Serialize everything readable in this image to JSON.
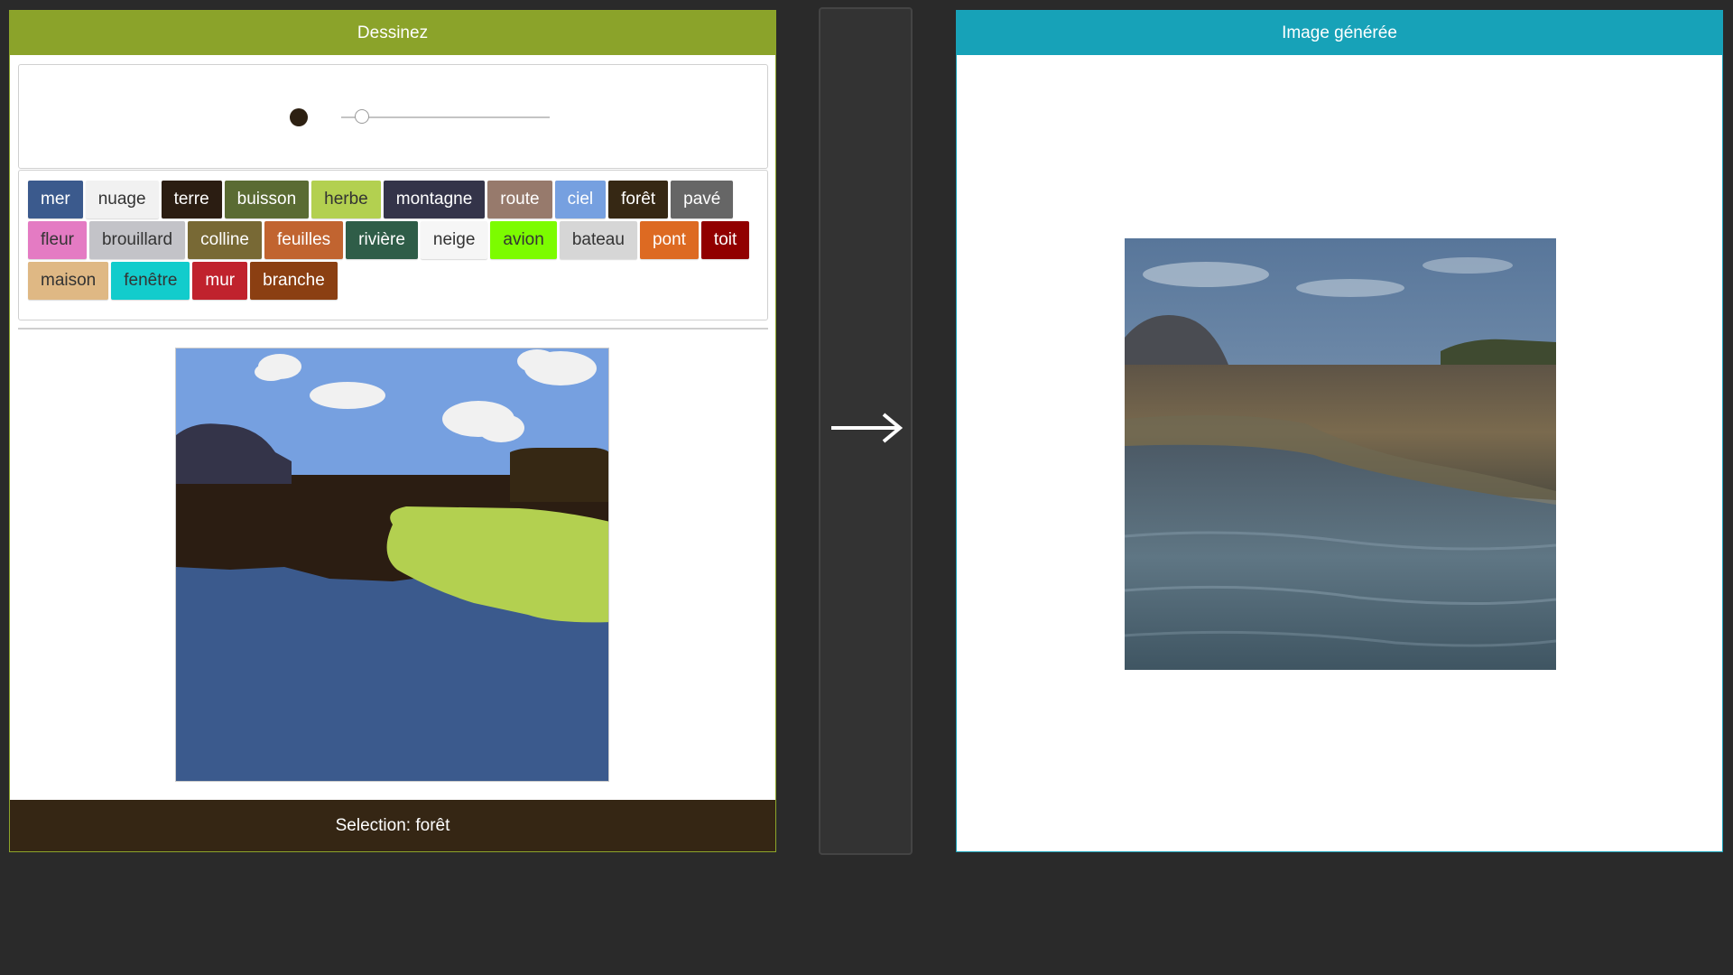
{
  "left_panel": {
    "title": "Dessinez",
    "selection_text": "Selection: forêt",
    "brush_color": "#2d2012",
    "brush_size_level": 0.1
  },
  "labels": [
    {
      "name": "mer",
      "bg": "#3b5a8d",
      "fg": "#ffffff"
    },
    {
      "name": "nuage",
      "bg": "#f1f1f1",
      "fg": "#333333"
    },
    {
      "name": "terre",
      "bg": "#2b1d12",
      "fg": "#ffffff"
    },
    {
      "name": "buisson",
      "bg": "#5a6b33",
      "fg": "#ffffff"
    },
    {
      "name": "herbe",
      "bg": "#b3d050",
      "fg": "#333333"
    },
    {
      "name": "montagne",
      "bg": "#343449",
      "fg": "#ffffff"
    },
    {
      "name": "route",
      "bg": "#977a6c",
      "fg": "#ffffff"
    },
    {
      "name": "ciel",
      "bg": "#76a0e0",
      "fg": "#ffffff"
    },
    {
      "name": "forêt",
      "bg": "#362814",
      "fg": "#ffffff"
    },
    {
      "name": "pavé",
      "bg": "#666666",
      "fg": "#ffffff"
    },
    {
      "name": "fleur",
      "bg": "#e47bc3",
      "fg": "#333333"
    },
    {
      "name": "brouillard",
      "bg": "#c3c3c8",
      "fg": "#333333"
    },
    {
      "name": "colline",
      "bg": "#786935",
      "fg": "#ffffff"
    },
    {
      "name": "feuilles",
      "bg": "#c16430",
      "fg": "#ffffff"
    },
    {
      "name": "rivière",
      "bg": "#2f5d48",
      "fg": "#ffffff"
    },
    {
      "name": "neige",
      "bg": "#f6f6f6",
      "fg": "#333333"
    },
    {
      "name": "avion",
      "bg": "#7cfc00",
      "fg": "#333333"
    },
    {
      "name": "bateau",
      "bg": "#d6d6d6",
      "fg": "#333333"
    },
    {
      "name": "pont",
      "bg": "#dd6a22",
      "fg": "#ffffff"
    },
    {
      "name": "toit",
      "bg": "#910000",
      "fg": "#ffffff"
    },
    {
      "name": "maison",
      "bg": "#dfb884",
      "fg": "#333333"
    },
    {
      "name": "fenêtre",
      "bg": "#12cccc",
      "fg": "#333333"
    },
    {
      "name": "mur",
      "bg": "#c0222d",
      "fg": "#ffffff"
    },
    {
      "name": "branche",
      "bg": "#8b3f12",
      "fg": "#ffffff"
    }
  ],
  "middle": {
    "arrow_icon": "arrow-right-icon"
  },
  "right_panel": {
    "title": "Image générée"
  },
  "colors": {
    "left_accent": "#8ba32a",
    "right_accent": "#17a2b8",
    "footer_bg": "#352614",
    "background": "#2a2a2a"
  }
}
